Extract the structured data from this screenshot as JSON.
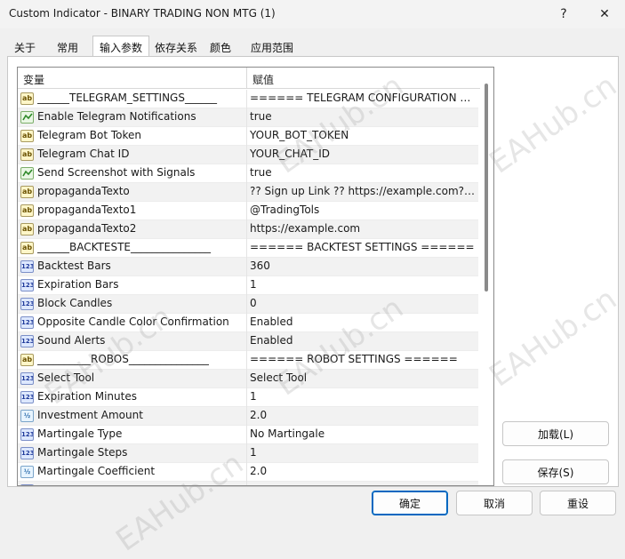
{
  "window": {
    "title": "Custom Indicator - BINARY TRADING NON MTG (1)",
    "help_label": "?",
    "close_label": "✕"
  },
  "tabs": [
    {
      "label": "关于"
    },
    {
      "label": "常用"
    },
    {
      "label": "输入参数",
      "active": true
    },
    {
      "label": "依存关系"
    },
    {
      "label": "颜色"
    },
    {
      "label": "应用范围"
    }
  ],
  "grid": {
    "headers": {
      "variable": "变量",
      "value": "赋值"
    },
    "rows": [
      {
        "icon": "ab",
        "name": "______TELEGRAM_SETTINGS______",
        "value": "====== TELEGRAM CONFIGURATION ======"
      },
      {
        "icon": "bool",
        "name": "Enable Telegram Notifications",
        "value": "true"
      },
      {
        "icon": "ab",
        "name": "Telegram Bot Token",
        "value": "YOUR_BOT_TOKEN"
      },
      {
        "icon": "ab",
        "name": "Telegram Chat ID",
        "value": "YOUR_CHAT_ID"
      },
      {
        "icon": "bool",
        "name": "Send Screenshot with Signals",
        "value": "true"
      },
      {
        "icon": "ab",
        "name": "propagandaTexto",
        "value": "?? Sign up Link ?? https://example.com?? Subscribe to our channel"
      },
      {
        "icon": "ab",
        "name": "propagandaTexto1",
        "value": "@TradingTols"
      },
      {
        "icon": "ab",
        "name": "propagandaTexto2",
        "value": "https://example.com"
      },
      {
        "icon": "ab",
        "name": "______BACKTESTE_______________",
        "value": "====== BACKTEST SETTINGS ======"
      },
      {
        "icon": "123",
        "name": "Backtest Bars",
        "value": "360"
      },
      {
        "icon": "123",
        "name": "Expiration Bars",
        "value": "1"
      },
      {
        "icon": "123",
        "name": "Block Candles",
        "value": "0"
      },
      {
        "icon": "123",
        "name": "Opposite Candle Color Confirmation",
        "value": "Enabled"
      },
      {
        "icon": "123",
        "name": "Sound Alerts",
        "value": "Enabled"
      },
      {
        "icon": "ab",
        "name": "__________ROBOS_______________",
        "value": "====== ROBOT SETTINGS ======"
      },
      {
        "icon": "123",
        "name": "Select Tool",
        "value": "Select Tool"
      },
      {
        "icon": "123",
        "name": "Expiration Minutes",
        "value": "1"
      },
      {
        "icon": "real",
        "name": "Investment Amount",
        "value": "2.0"
      },
      {
        "icon": "123",
        "name": "Martingale Type",
        "value": "No Martingale"
      },
      {
        "icon": "123",
        "name": "Martingale Steps",
        "value": "1"
      },
      {
        "icon": "real",
        "name": "Martingale Coefficient",
        "value": "2.0"
      },
      {
        "icon": "123",
        "name": "",
        "value": ""
      }
    ]
  },
  "icons": {
    "ab": "ab",
    "123": "123",
    "real": "½"
  },
  "buttons": {
    "load": "加载(L)",
    "save": "保存(S)",
    "ok": "确定",
    "cancel": "取消",
    "reset": "重设"
  },
  "watermark": "EAHub.cn"
}
